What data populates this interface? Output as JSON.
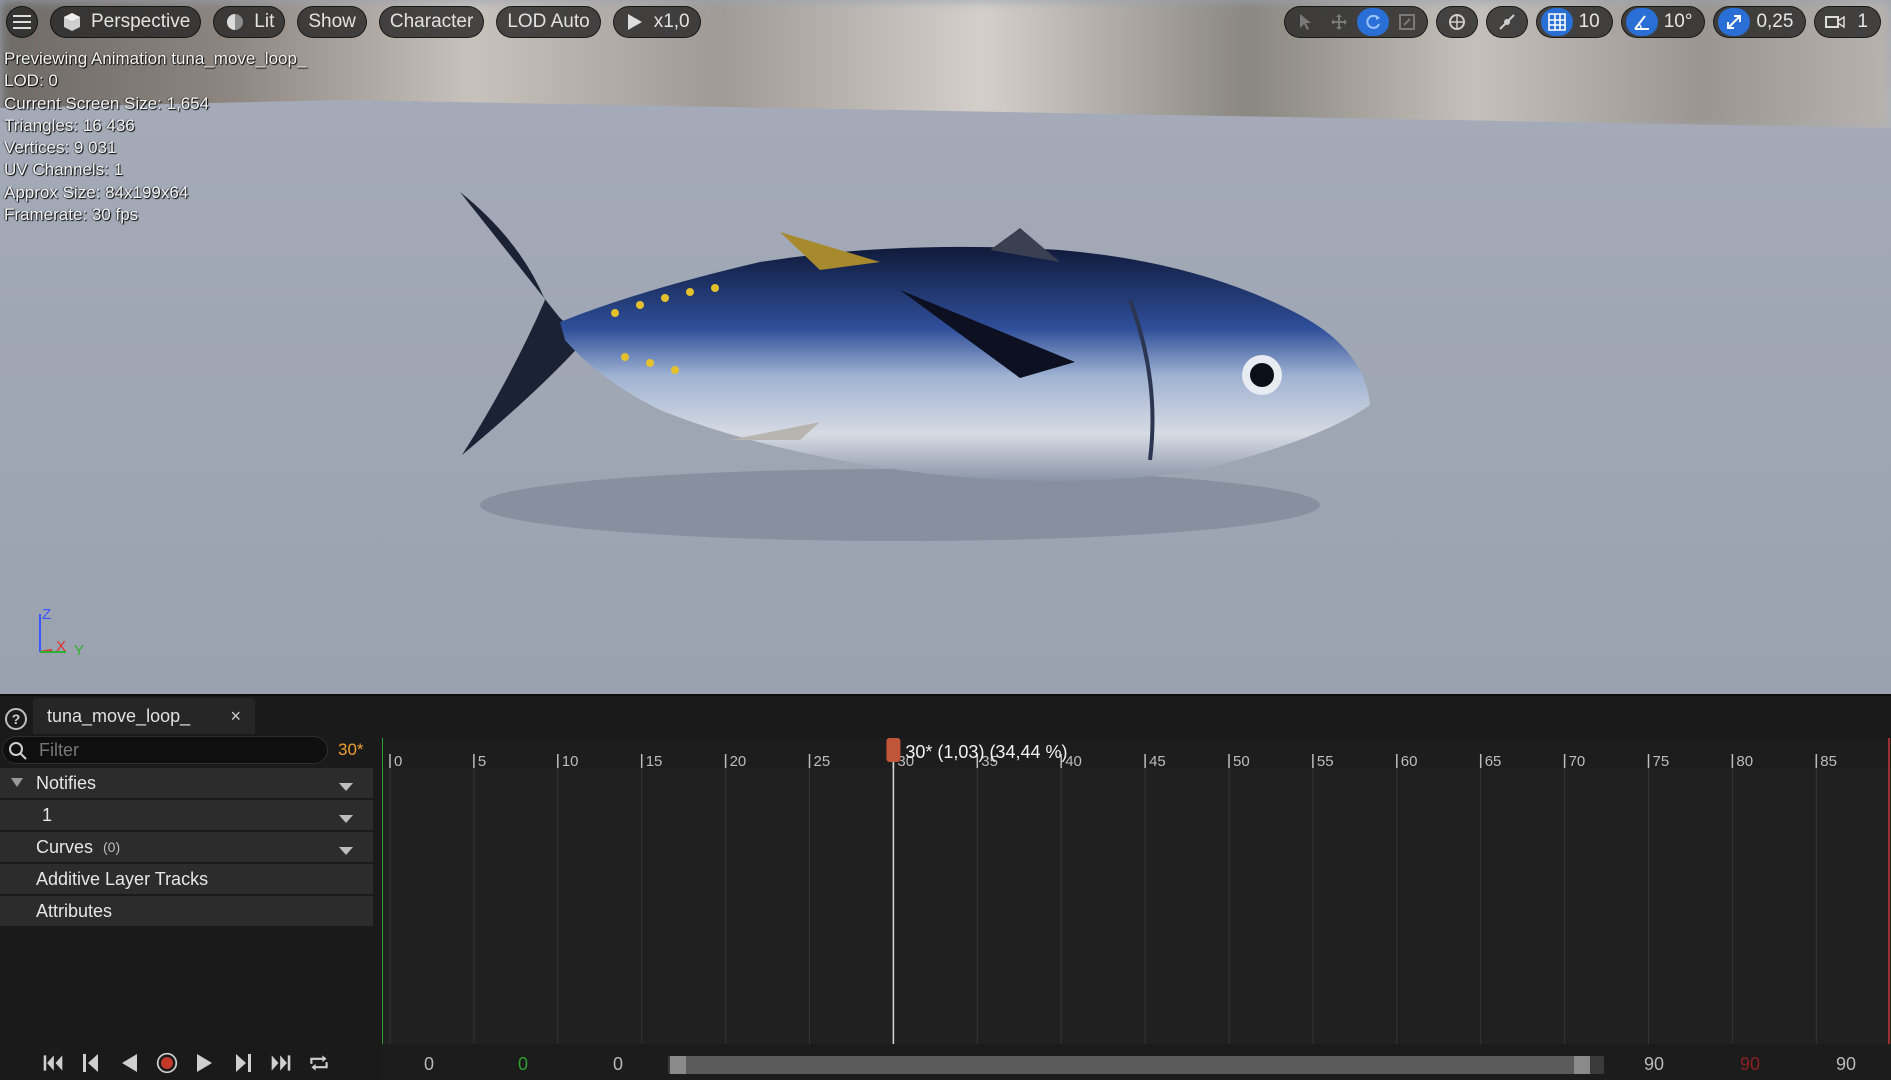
{
  "viewport_toolbar": {
    "menu_icon": "hamburger-icon",
    "perspective_label": "Perspective",
    "lit_label": "Lit",
    "show_label": "Show",
    "character_label": "Character",
    "lod_label": "LOD Auto",
    "play_rate_label": "x1,0",
    "grid_snap_value": "10",
    "rotation_snap_value": "10°",
    "scale_snap_value": "0,25",
    "camera_speed_value": "1"
  },
  "stats": {
    "line1": "Previewing Animation tuna_move_loop_",
    "line2": "LOD: 0",
    "line3": "Current Screen Size: 1,654",
    "line4": "Triangles: 16 436",
    "line5": "Vertices: 9 031",
    "line6": "UV Channels: 1",
    "line7": "Approx Size: 84x199x64",
    "line8": "Framerate: 30 fps"
  },
  "axis": {
    "z": "Z",
    "x": "X",
    "y": "Y"
  },
  "tab": {
    "label": "tuna_move_loop_",
    "close": "×"
  },
  "filter": {
    "placeholder": "Filter",
    "current_frame": "30*"
  },
  "tracks": {
    "notifies": "Notifies",
    "notify_track_1": "1",
    "curves": "Curves",
    "curves_count": "(0)",
    "additive": "Additive Layer Tracks",
    "attributes": "Attributes"
  },
  "timeline": {
    "ticks": [
      "0",
      "5",
      "10",
      "15",
      "20",
      "25",
      "30",
      "35",
      "40",
      "45",
      "50",
      "55",
      "60",
      "65",
      "70",
      "75",
      "80",
      "85"
    ],
    "scrubber_label": "30* (1,03) (34,44 %)",
    "scrubber_frame": 30,
    "max_frame": 90
  },
  "range": {
    "start_view": "0",
    "start_play": "0",
    "start_work": "0",
    "end_work": "90",
    "end_play": "90",
    "end_view": "90"
  },
  "colors": {
    "accent_blue": "#2a6fd6",
    "scrubber": "#c0553a",
    "frame_orange": "#f0a030"
  }
}
